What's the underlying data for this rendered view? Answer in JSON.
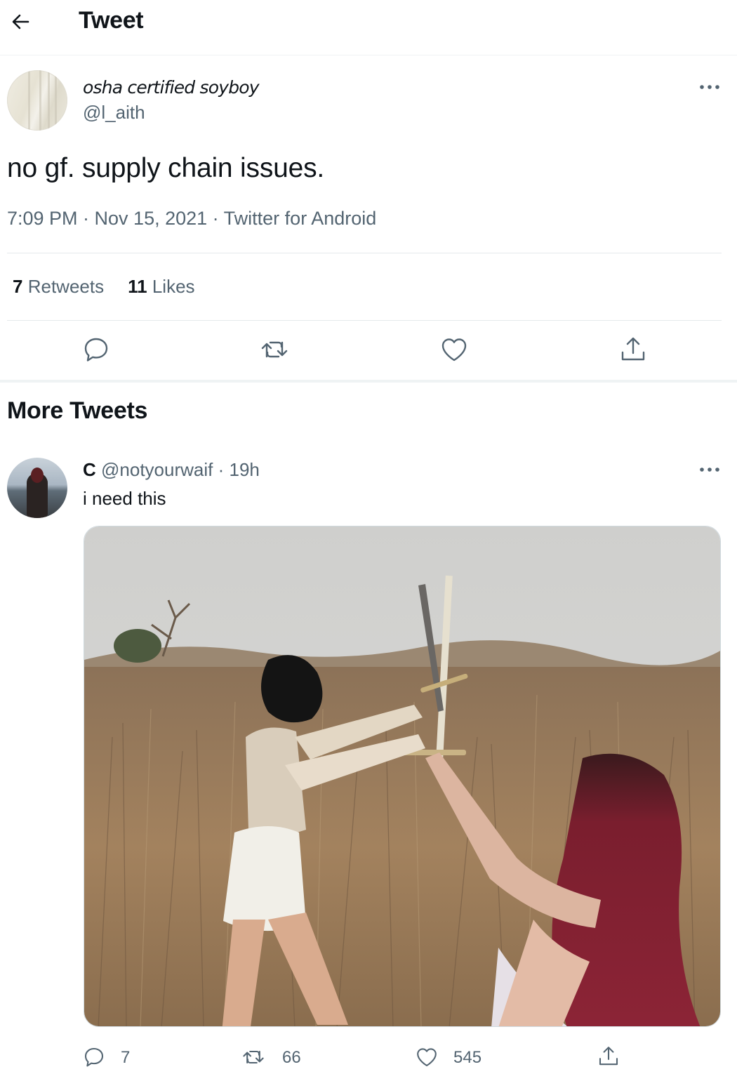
{
  "header": {
    "title": "Tweet"
  },
  "main_tweet": {
    "display_name": "osha certified soyboy",
    "handle": "@l_aith",
    "text": "no gf. supply chain issues.",
    "meta": "7:09 PM · Nov 15, 2021 · Twitter for Android",
    "stats": {
      "retweets_count": "7",
      "retweets_label": "Retweets",
      "likes_count": "11",
      "likes_label": "Likes"
    }
  },
  "more_tweets": {
    "heading": "More Tweets",
    "tweets": [
      {
        "display_name": "C",
        "handle": "@notyourwaif",
        "time": "· 19h",
        "text": "i need this",
        "image_description": "photo",
        "replies": "7",
        "retweets": "66",
        "likes": "545"
      }
    ]
  },
  "colors": {
    "text": "#0f1419",
    "muted": "#536471",
    "divider": "#eff3f4"
  },
  "icons": [
    "back-arrow-icon",
    "more-icon",
    "reply-icon",
    "retweet-icon",
    "like-icon",
    "share-icon"
  ]
}
